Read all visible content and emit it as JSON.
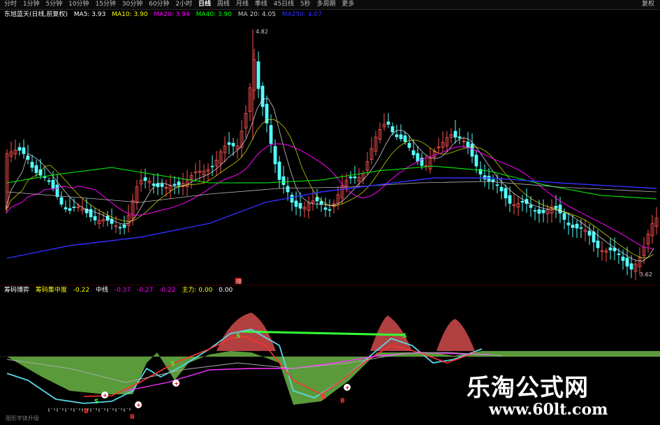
{
  "toolbar": {
    "tabs": [
      "分时",
      "1分钟",
      "5分钟",
      "10分钟",
      "15分钟",
      "30分钟",
      "60分钟",
      "2小时",
      "日线",
      "周线",
      "月线",
      "季线",
      "45日线",
      "5秒",
      "多周期",
      "更多"
    ],
    "active": "日线",
    "right_label": "复权"
  },
  "ma_bar": {
    "title": "东旭蓝天(日线,前复权)",
    "ma5": "MA5: 3.93",
    "ma10": "MA10: 3.90",
    "ma20": "MA20: 3.94",
    "ma40": "MA40: 3.90",
    "ma": "MA 20: 4.05",
    "ma250": "MA250: 4.07"
  },
  "price_marks": {
    "high": "4.82",
    "low": "3.62",
    "mid_tag": "除"
  },
  "indicator_bar": {
    "name": "筹码博弈",
    "sub": "筹码集中度",
    "v1": "-0.22",
    "mid_label": "中线",
    "v2": "-0.37",
    "v3": "-0.27",
    "v4": "-0.22",
    "main_label": "主力: 0.00",
    "v5": "0.00"
  },
  "markers": {
    "buy": "B",
    "sell": "S"
  },
  "bottom_label": "图形字体升级",
  "watermark": {
    "line1": "乐淘公式网",
    "line2": "www.60lt.com"
  },
  "colors": {
    "up": "#ff5050",
    "down": "#54ffff",
    "ma5": "#ffffff",
    "ma10": "#ffff00",
    "ma20": "#ff00ff",
    "ma40": "#00ff00",
    "ma250": "#3030ff"
  }
}
